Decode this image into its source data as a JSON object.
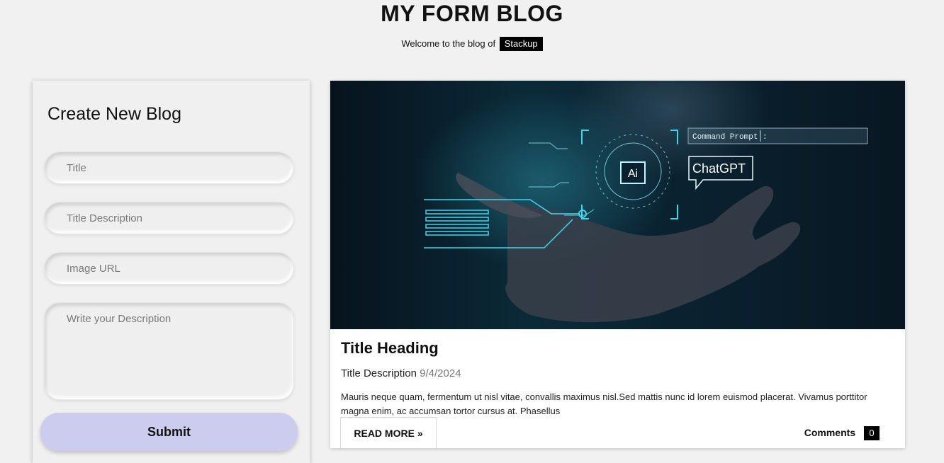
{
  "header": {
    "title": "MY FORM BLOG",
    "subtitle_prefix": "Welcome to the blog of",
    "brand": "Stackup"
  },
  "form": {
    "heading": "Create New Blog",
    "title_placeholder": "Title",
    "description_placeholder": "Title Description",
    "image_placeholder": "Image URL",
    "body_placeholder": "Write your Description",
    "submit_label": "Submit"
  },
  "post": {
    "title": "Title Heading",
    "description": "Title Description",
    "date": "9/4/2024",
    "body": "Mauris neque quam, fermentum ut nisl vitae, convallis maximus nisl.Sed mattis nunc id lorem euismod placerat. Vivamus porttitor magna enim, ac accumsan tortor cursus at. Phasellus",
    "read_more_label": "READ MORE »",
    "comments_label": "Comments",
    "comments_count": "0",
    "image": {
      "chip_label": "Ai",
      "prompt_label": "Command Prompt :",
      "bubble_label": "ChatGPT"
    }
  },
  "colors": {
    "page_bg": "#f1f1f1",
    "submit_bg": "#cccdee",
    "accent_cyan": "#3fd6f0"
  }
}
